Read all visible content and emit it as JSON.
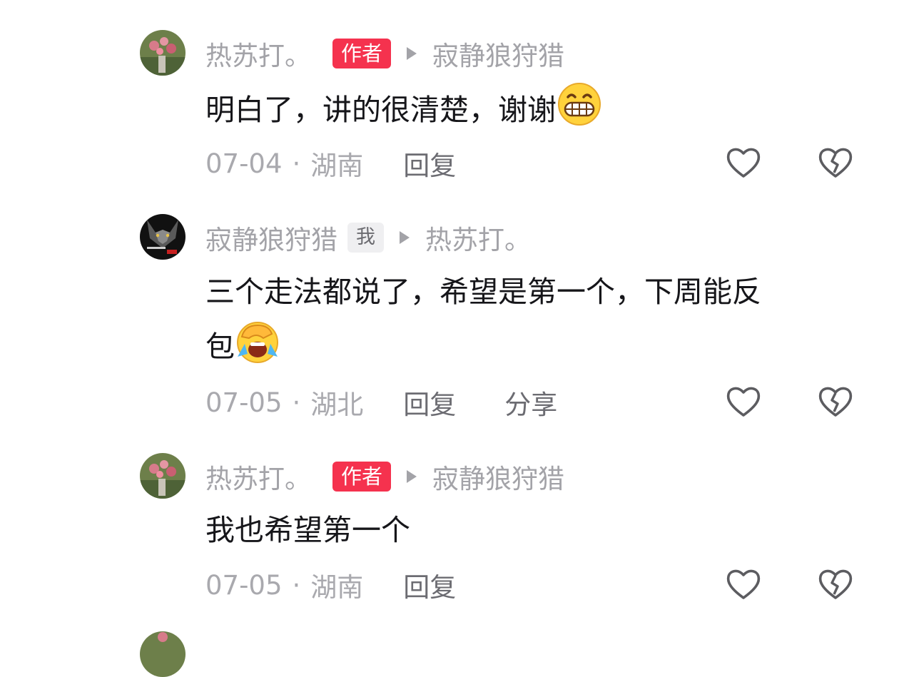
{
  "comments": [
    {
      "author": "热苏打。",
      "badge": "作者",
      "reply_to": "寂静狼狩猎",
      "text": "明白了，讲的很清楚，谢谢",
      "emoji": "grinning-face-emoji",
      "date": "07-04",
      "location": "湖南",
      "reply_label": "回复",
      "avatar": "flower-avatar"
    },
    {
      "author": "寂静狼狩猎",
      "badge": "我",
      "reply_to": "热苏打。",
      "text_line1": "三个走法都说了，希望是第一个，下周能反",
      "text_line2": "包",
      "emoji": "crying-laughing-emoji",
      "date": "07-05",
      "location": "湖北",
      "reply_label": "回复",
      "share_label": "分享",
      "avatar": "wolf-avatar"
    },
    {
      "author": "热苏打。",
      "badge": "作者",
      "reply_to": "寂静狼狩猎",
      "text": "我也希望第一个",
      "date": "07-05",
      "location": "湖南",
      "reply_label": "回复",
      "avatar": "flower-avatar"
    }
  ],
  "colors": {
    "author_badge": "#f5324e",
    "meta_text": "#a3a3a8",
    "body_text": "#16161a",
    "icon": "#5c5c60"
  },
  "icons": [
    "like-heart-icon",
    "dislike-broken-heart-icon",
    "reply-arrow-icon"
  ],
  "dot_separator": "·"
}
